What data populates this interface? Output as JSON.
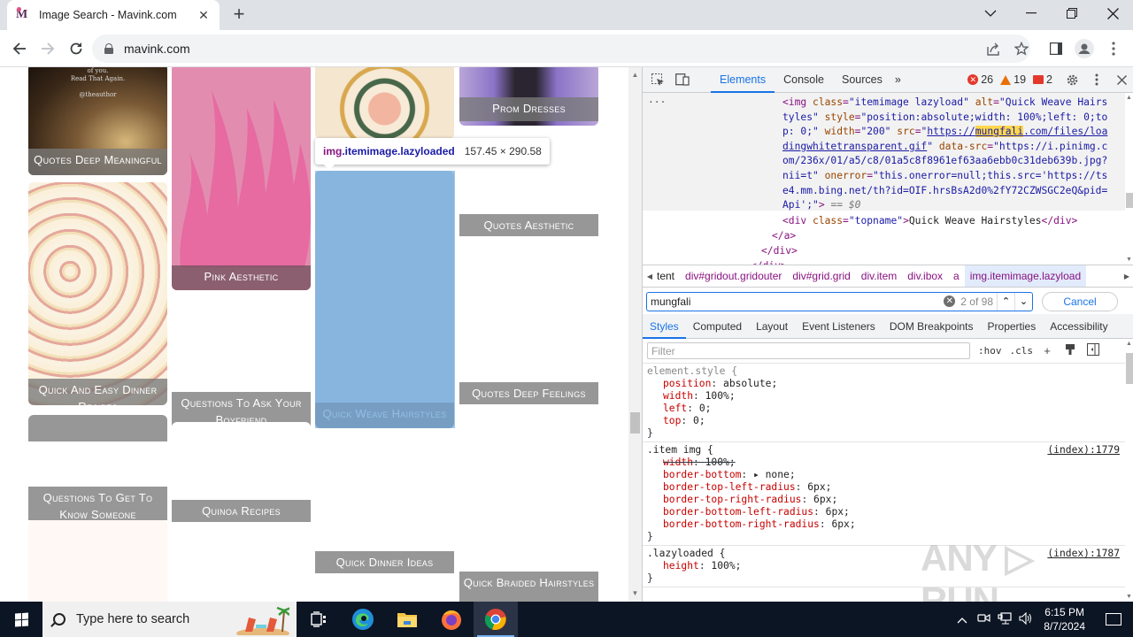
{
  "browser": {
    "tab": {
      "title": "Image Search - Mavink.com",
      "favicon": "mavink-m-icon"
    },
    "new_tab_label": "+",
    "address": {
      "url": "mavink.com"
    },
    "window_controls": [
      "tab-search",
      "minimize",
      "restore",
      "close"
    ]
  },
  "page": {
    "tooltip": {
      "tag": "img",
      "classes": ".itemimage.lazyloaded",
      "size": "157.45 × 290.58"
    },
    "cards": [
      {
        "label": "Quotes Deep Meaningful"
      },
      {
        "label": "Pink Aesthetic"
      },
      {
        "label": "Prom Dresses"
      },
      {
        "label": "Quotes Aesthetic"
      },
      {
        "label": "Quick And Easy Dinner Recipes"
      },
      {
        "label": "Questions To Ask Your Boyfriend"
      },
      {
        "label": "Quick Weave Hairstyles"
      },
      {
        "label": "Quotes Deep Feelings"
      },
      {
        "label": "Questions To Get To Know Someone"
      },
      {
        "label": "Quinoa Recipes"
      },
      {
        "label": "Quick Dinner Ideas"
      },
      {
        "label": "Quick Braided Hairstyles"
      }
    ]
  },
  "devtools": {
    "tabs": [
      {
        "label": "Elements",
        "active": true
      },
      {
        "label": "Console",
        "active": false
      },
      {
        "label": "Sources",
        "active": false
      }
    ],
    "more_tabs": "»",
    "counts": {
      "errors": "26",
      "warnings": "19",
      "issues": "2"
    },
    "dom": {
      "ellipsis": "...",
      "lines": [
        "<img class=\"itemimage lazyload\" alt=\"Quick Weave Hairs",
        "tyles\" style=\"position:absolute;width: 100%;left: 0;to",
        "p: 0;\" width=\"200\" src=\"https://mungfali.com/files/loa",
        "dingwhitetransparent.gif\" data-src=\"https://i.pinimg.c",
        "om/236x/01/a5/c8/01a5c8f8961ef63aa6ebb0c31deb639b.jpg?",
        "nii=t\" onerror=\"this.onerror=null;this.src='https://ts",
        "e4.mm.bing.net/th?id=OIF.hrsBsA2d0%2fY72CZWSGC2eQ&pid=",
        "Api';\"> == $0",
        "<div class=\"topname\">Quick Weave Hairstyles</div>",
        "</a>",
        "</div>",
        "</div>"
      ],
      "highlight": "mungfali"
    },
    "breadcrumbs": [
      "tent",
      "div#gridout.gridouter",
      "div#grid.grid",
      "div.item",
      "div.ibox",
      "a",
      "img.itemimage.lazyload"
    ],
    "search": {
      "value": "mungfali",
      "count": "2 of 98",
      "cancel_label": "Cancel"
    },
    "sub_tabs": [
      {
        "label": "Styles",
        "active": true
      },
      {
        "label": "Computed",
        "active": false
      },
      {
        "label": "Layout",
        "active": false
      },
      {
        "label": "Event Listeners",
        "active": false
      },
      {
        "label": "DOM Breakpoints",
        "active": false
      },
      {
        "label": "Properties",
        "active": false
      },
      {
        "label": "Accessibility",
        "active": false
      }
    ],
    "filter": {
      "placeholder": "Filter",
      "hov": ":hov",
      "cls": ".cls"
    },
    "rules": [
      {
        "selector": "element.style {",
        "source": "",
        "props": [
          {
            "name": "position",
            "value": "absolute;"
          },
          {
            "name": "width",
            "value": "100%;"
          },
          {
            "name": "left",
            "value": "0;"
          },
          {
            "name": "top",
            "value": "0;"
          }
        ]
      },
      {
        "selector": ".item img {",
        "source": "(index):1779",
        "props": [
          {
            "name": "width",
            "value": "100%;",
            "struck": true
          },
          {
            "name": "border-bottom",
            "value": "▸ none;"
          },
          {
            "name": "border-top-left-radius",
            "value": "6px;"
          },
          {
            "name": "border-top-right-radius",
            "value": "6px;"
          },
          {
            "name": "border-bottom-left-radius",
            "value": "6px;"
          },
          {
            "name": "border-bottom-right-radius",
            "value": "6px;"
          }
        ]
      },
      {
        "selector": ".lazyloaded {",
        "source": "(index):1787",
        "props": [
          {
            "name": "height",
            "value": "100%;"
          }
        ]
      }
    ],
    "close_brace": "}"
  },
  "watermark": "ANY ▷ RUN",
  "taskbar": {
    "search_placeholder": "Type here to search",
    "apps": [
      "task-view",
      "edge",
      "file-explorer",
      "firefox",
      "chrome"
    ],
    "time": "6:15 PM",
    "date": "8/7/2024"
  }
}
